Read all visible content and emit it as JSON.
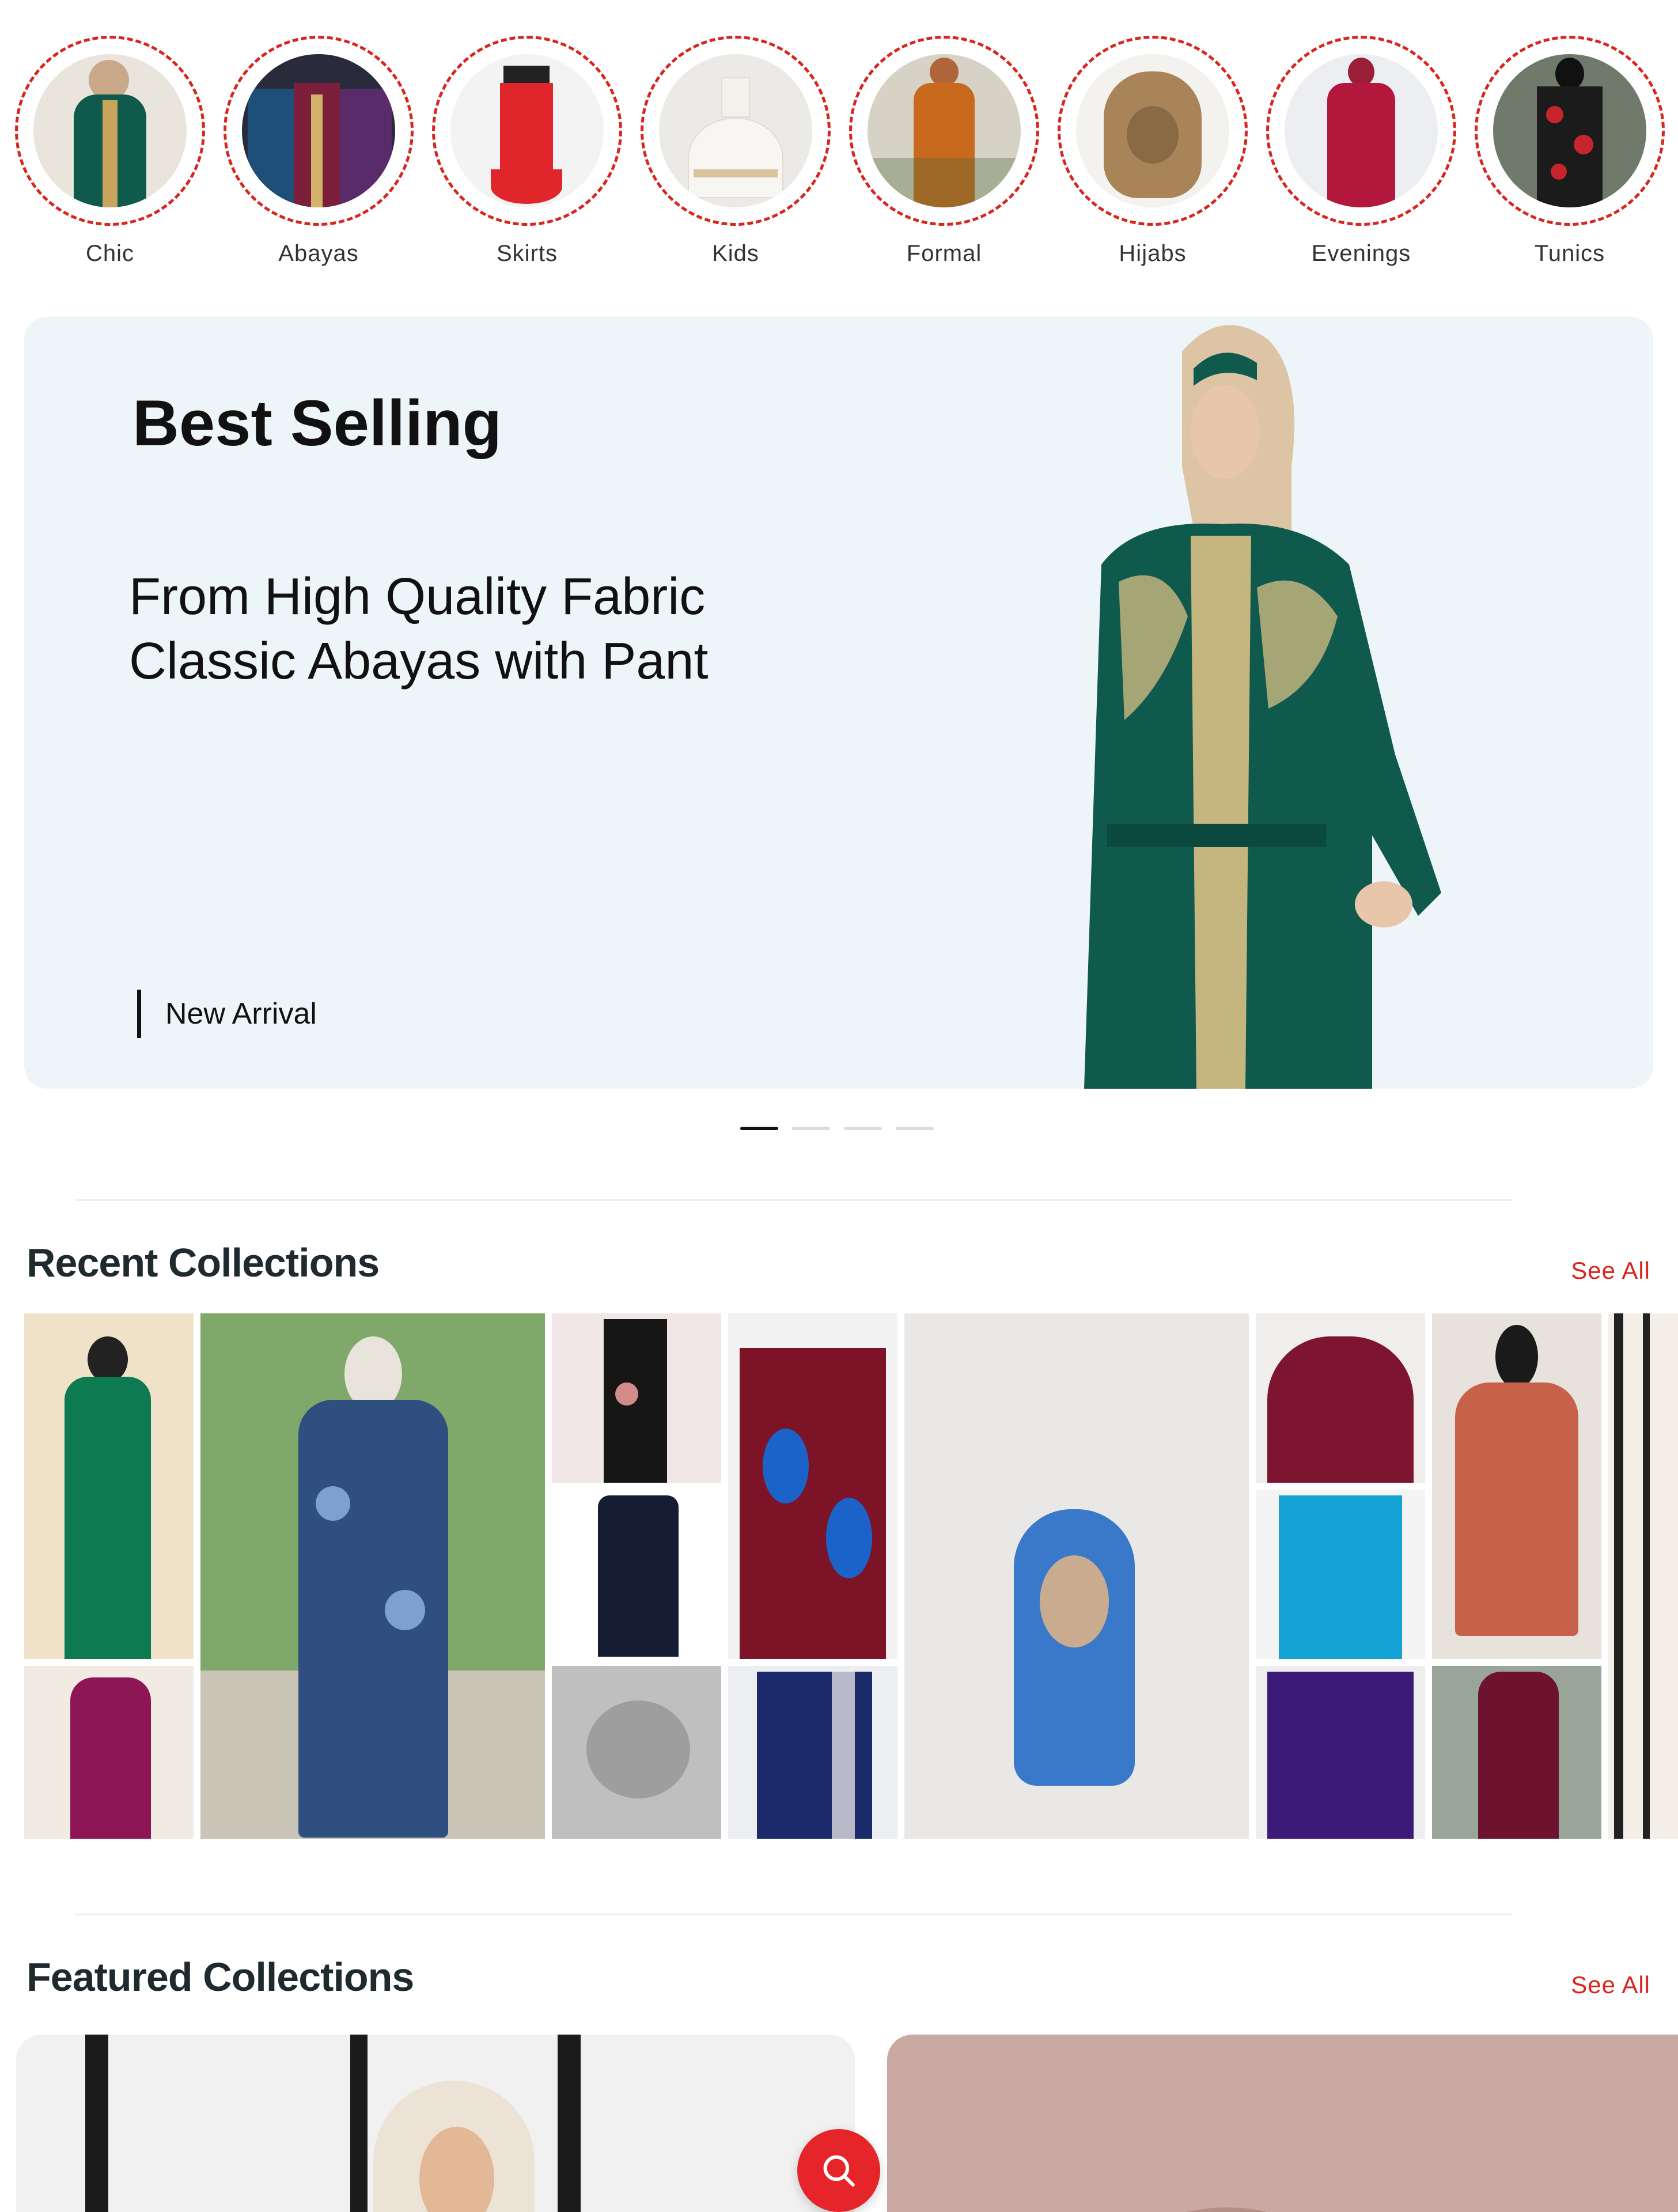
{
  "categories": [
    {
      "label": "Chic",
      "icon": "chic-dress-image"
    },
    {
      "label": "Abayas",
      "icon": "abayas-image"
    },
    {
      "label": "Skirts",
      "icon": "skirts-image"
    },
    {
      "label": "Kids",
      "icon": "kids-dress-image"
    },
    {
      "label": "Formal",
      "icon": "formal-dress-image"
    },
    {
      "label": "Hijabs",
      "icon": "hijab-image"
    },
    {
      "label": "Evenings",
      "icon": "evening-dress-image"
    },
    {
      "label": "Tunics",
      "icon": "tunic-image"
    }
  ],
  "banner": {
    "title": "Best Selling",
    "subtitle_line1": "From High Quality Fabric",
    "subtitle_line2": "Classic Abayas with Pant",
    "tag": "New Arrival",
    "slide_count": 4,
    "active_slide": 1
  },
  "recent": {
    "title": "Recent Collections",
    "see_all": "See All"
  },
  "featured": {
    "title": "Featured Collections",
    "see_all": "See All"
  },
  "search_button": {
    "icon": "search-icon"
  },
  "colors": {
    "accent": "#d9251d",
    "banner_bg": "#eef5f8",
    "heading": "#1f2a2e"
  }
}
